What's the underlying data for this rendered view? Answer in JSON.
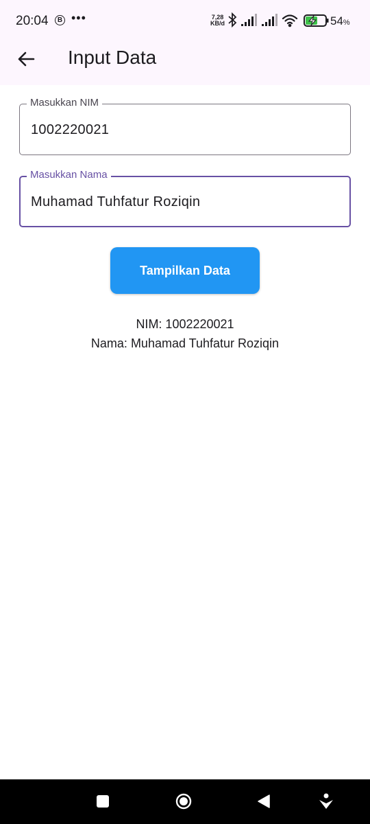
{
  "status_bar": {
    "time": "20:04",
    "b_badge": "B",
    "dots": "•••",
    "speed_value": "7,28",
    "speed_unit": "KB/d",
    "battery_percent": "54",
    "battery_percent_sign": "%"
  },
  "app_bar": {
    "title": "Input Data",
    "back_icon": "arrow-left"
  },
  "form": {
    "nim_label": "Masukkan NIM",
    "nim_value": "1002220021",
    "nama_label": "Masukkan Nama",
    "nama_value": "Muhamad Tuhfatur Roziqin"
  },
  "button": {
    "label": "Tampilkan Data"
  },
  "result": {
    "nim_line": "NIM: 1002220021",
    "nama_line": "Nama: Muhamad Tuhfatur Roziqin"
  },
  "colors": {
    "app_bar_bg": "#fdf6fe",
    "focused_field": "#6750a4",
    "button_bg": "#2196f3",
    "battery_green": "#3ec24a"
  }
}
